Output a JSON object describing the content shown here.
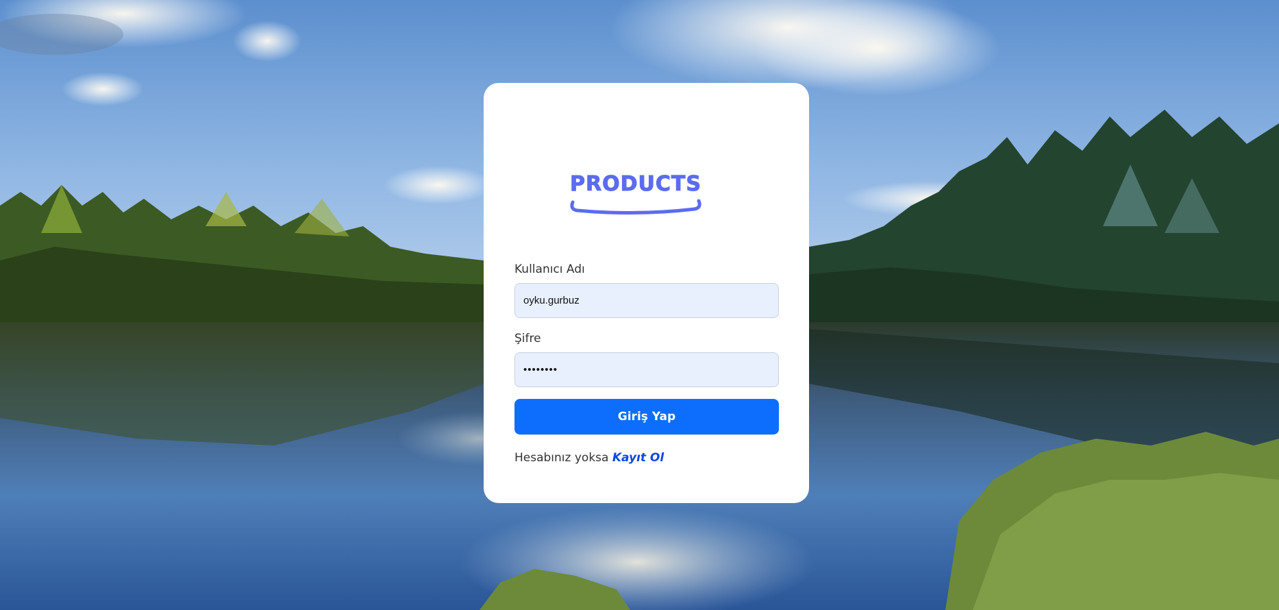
{
  "brand": {
    "logo_text": "PRODUCTS",
    "logo_color": "#5b6cf0"
  },
  "login_form": {
    "username_label": "Kullanıcı Adı",
    "username_value": "oyku.gurbuz",
    "password_label": "Şifre",
    "password_value": "********",
    "submit_label": "Giriş Yap",
    "submit_color": "#0d6efd",
    "register_prompt": "Hesabınız yoksa",
    "register_link": "Kayıt Ol"
  },
  "background": {
    "description_icon": "lake-forest-landscape"
  }
}
